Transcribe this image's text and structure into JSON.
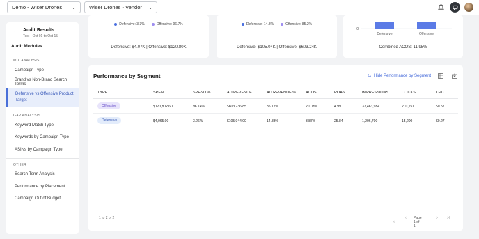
{
  "topbar": {
    "account_select": "Demo - Wiser Drones",
    "profile_select": "Wiser Drones - Vendor"
  },
  "sidebar": {
    "title": "Audit Results",
    "subtitle": "Test - Oct 01 to Oct 15",
    "modules_label": "Audit Modules",
    "sections": [
      {
        "label": "MIX ANALYSIS",
        "items": [
          "Campaign Type",
          "Brand vs Non-Brand Search Terms",
          "Defensive vs Offensive Product Target"
        ]
      },
      {
        "label": "GAP ANALYSIS",
        "items": [
          "Keyword Match Type",
          "Keywords by Campaign Type",
          "ASINs by Campaign Type"
        ]
      },
      {
        "label": "OTHER",
        "items": [
          "Search Term Analysis",
          "Performance by Placement",
          "Campaign Out of Budget"
        ]
      }
    ]
  },
  "cards": [
    {
      "legend": [
        {
          "label": "Defensive: 3.3%",
          "color": "#4a6fe0"
        },
        {
          "label": "Offensive: 96.7%",
          "color": "#9d8df0"
        }
      ],
      "footer": "Defensive: $4.07K | Offensive: $120.80K"
    },
    {
      "legend": [
        {
          "label": "Defensive: 14.8%",
          "color": "#4a6fe0"
        },
        {
          "label": "Offensive: 85.2%",
          "color": "#9d8df0"
        }
      ],
      "footer": "Defensive: $105.04K | Offensive: $603.24K"
    },
    {
      "footer": "Combined ACOS: 11.95%"
    }
  ],
  "acos_chart": {
    "type": "bar",
    "categories": [
      "Defensive",
      "Offensive"
    ],
    "y_tick_zero": "0",
    "color": "#5b7be6"
  },
  "table": {
    "title": "Performance by Segment",
    "hide_link": "Hide Performance by Segment",
    "columns": [
      "TYPE",
      "SPEND",
      "SPEND %",
      "AD REVENUE",
      "AD REVENUE %",
      "ACOS",
      "ROAS",
      "IMPRESSIONS",
      "CLICKS",
      "CPC"
    ],
    "rows": [
      [
        "Offensive",
        "$120,802.60",
        "96.74%",
        "$603,236.85",
        "85.17%",
        "20.03%",
        "4.99",
        "37,463,984",
        "210,251",
        "$0.57"
      ],
      [
        "Defensive",
        "$4,065.00",
        "3.26%",
        "$105,044.00",
        "14.83%",
        "3.87%",
        "25.84",
        "1,206,700",
        "15,200",
        "$0.27"
      ]
    ],
    "range_text": "1 to 2 of 2",
    "page_text": "Page 1 of 1"
  }
}
